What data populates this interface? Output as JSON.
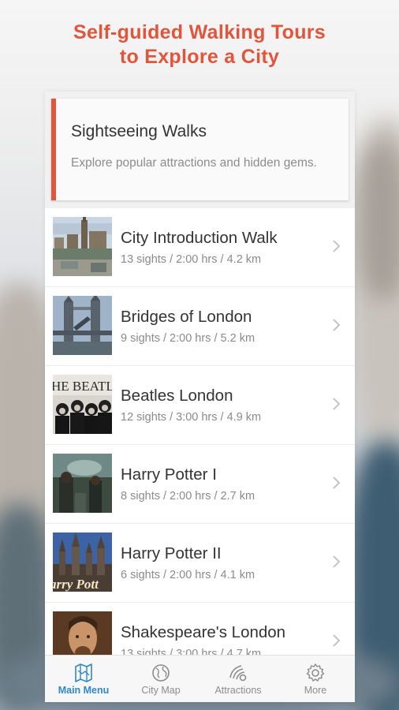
{
  "headline": {
    "line1": "Self-guided Walking Tours",
    "line2": "to Explore a City"
  },
  "hero": {
    "title": "Sightseeing Walks",
    "description": "Explore popular attractions and hidden gems."
  },
  "tours": [
    {
      "title": "City Introduction Walk",
      "meta": "13 sights / 2:00 hrs / 4.2 km",
      "image": "london-skyline-photo"
    },
    {
      "title": "Bridges of London",
      "meta": "9 sights / 2:00 hrs / 5.2 km",
      "image": "tower-bridge-photo"
    },
    {
      "title": "Beatles London",
      "meta": "12 sights / 3:00 hrs / 4.9 km",
      "image": "beatles-photo",
      "image_text": "HE BEATLE"
    },
    {
      "title": "Harry Potter I",
      "meta": "8 sights / 2:00 hrs / 2.7 km",
      "image": "harry-potter-scene-photo"
    },
    {
      "title": "Harry Potter II",
      "meta": "6 sights / 2:00 hrs / 4.1 km",
      "image": "hogwarts-castle-photo",
      "image_text": "arry Pott"
    },
    {
      "title": "Shakespeare's London",
      "meta": "13 sights / 3:00 hrs / 4.7 km",
      "image": "shakespeare-portrait-photo"
    }
  ],
  "tabs": [
    {
      "label": "Main Menu",
      "icon": "map-icon",
      "active": true
    },
    {
      "label": "City Map",
      "icon": "globe-icon",
      "active": false
    },
    {
      "label": "Attractions",
      "icon": "attractions-icon",
      "active": false
    },
    {
      "label": "More",
      "icon": "gear-icon",
      "active": false
    }
  ],
  "colors": {
    "accent": "#e0553b",
    "tab_active": "#2f88c8",
    "tab_inactive": "#8c8c8c"
  }
}
